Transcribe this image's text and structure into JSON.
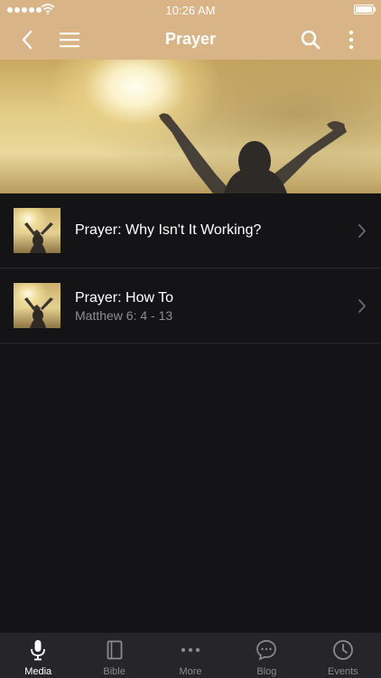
{
  "status_bar": {
    "time": "10:26 AM"
  },
  "nav": {
    "title": "Prayer"
  },
  "list": [
    {
      "title": "Prayer:  Why Isn't It Working?",
      "subtitle": ""
    },
    {
      "title": "Prayer:  How To",
      "subtitle": "Matthew 6: 4 - 13"
    }
  ],
  "tabs": [
    {
      "label": "Media",
      "icon": "microphone-icon",
      "active": true
    },
    {
      "label": "Bible",
      "icon": "book-icon",
      "active": false
    },
    {
      "label": "More",
      "icon": "more-dots-icon",
      "active": false
    },
    {
      "label": "Blog",
      "icon": "chat-bubble-icon",
      "active": false
    },
    {
      "label": "Events",
      "icon": "clock-icon",
      "active": false
    }
  ],
  "colors": {
    "header": "#d8b487",
    "background": "#141416",
    "tabbar": "#26262a"
  }
}
